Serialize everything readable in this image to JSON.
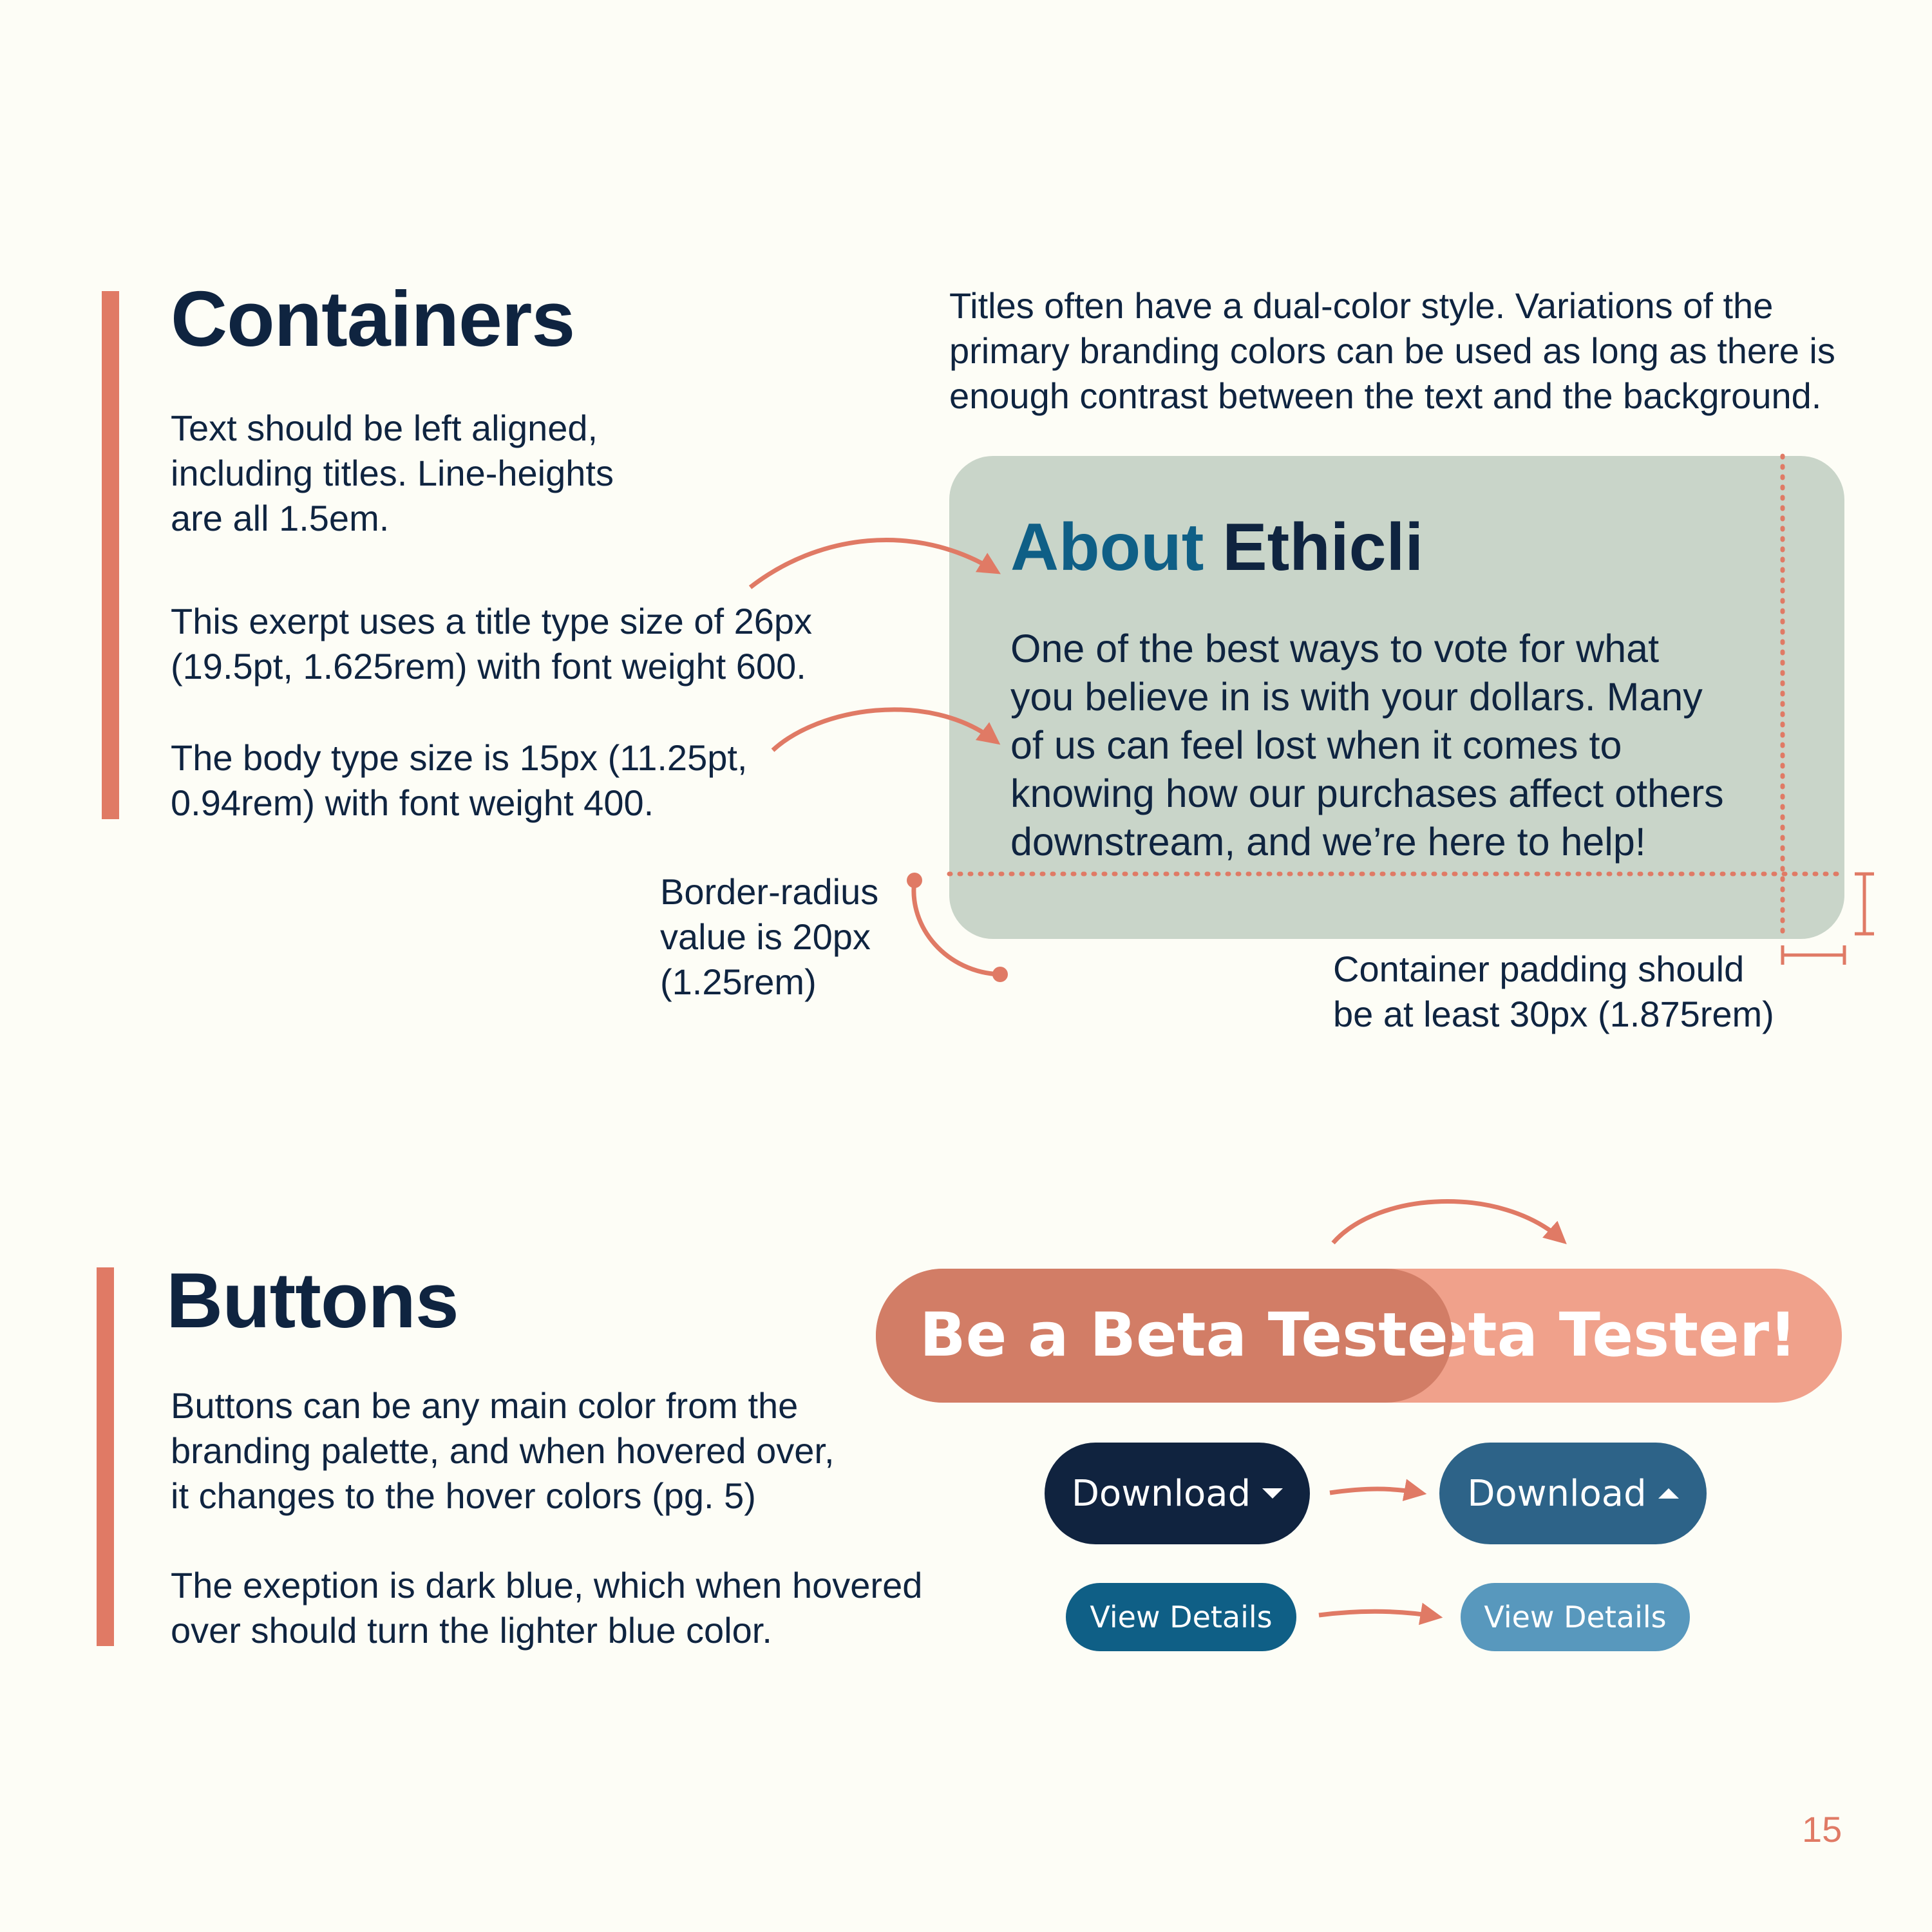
{
  "containers": {
    "heading": "Containers",
    "text_alignment": "Text should be left aligned,\nincluding titles. Line-heights\nare all 1.5em.",
    "title_size_note": "This exerpt uses a title type size of 26px\n(19.5pt, 1.625rem) with font weight 600.",
    "body_size_note": "The body type size is 15px (11.25pt,\n0.94rem) with font weight 400.",
    "dual_color_note": "Titles often have a dual-color style. Variations of the\nprimary branding colors can be used as long as there is\nenough contrast between the text and the background.",
    "example_card": {
      "title_part1": "About",
      "title_part2": "Ethicli",
      "body": "One of the best ways to vote for what\nyou believe in is with your dollars. Many\nof us can feel lost when it comes to\nknowing how our purchases affect others\ndownstream, and we’re here to help!"
    },
    "border_radius_note": "Border-radius\nvalue is 20px\n(1.25rem)",
    "padding_note": "Container padding should\nbe at least 30px (1.875rem)"
  },
  "buttons": {
    "heading": "Buttons",
    "color_note": "Buttons can be any main color from the\nbranding palette, and when hovered over,\nit changes to the hover colors (pg. 5)",
    "exception_note": "The exeption is dark blue, which when hovered\nover should turn the lighter blue color.",
    "beta_default": "Be a Beta Tester!",
    "beta_hover": "Be a Beta Tester!",
    "download_default": "Download",
    "download_hover": "Download",
    "view_default": "View Details",
    "view_hover": "View Details"
  },
  "page_number": "15",
  "colors": {
    "accent": "#e07a65",
    "dark_blue": "#0f2440",
    "blue_title": "#0f5f86",
    "card_bg": "#c9d5c9",
    "beta_default": "#d27d66",
    "beta_hover": "#f0a18b",
    "download_default": "#10233f",
    "download_hover": "#2d6388",
    "view_default": "#0f5f86",
    "view_hover": "#5898bd"
  },
  "icons": [
    "caret-down-icon",
    "caret-up-icon",
    "arrow-icon"
  ]
}
